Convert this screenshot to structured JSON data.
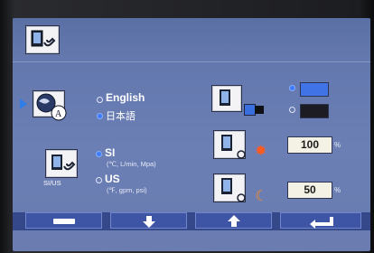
{
  "language": {
    "options": [
      {
        "label": "English",
        "selected": false
      },
      {
        "label": "日本語",
        "selected": true
      }
    ]
  },
  "units": {
    "icon_caption": "SI/US",
    "options": [
      {
        "label": "SI",
        "detail": "(℃, L/min, Mpa)",
        "selected": true
      },
      {
        "label": "US",
        "detail": "(℉, gpm, psi)",
        "selected": false
      }
    ]
  },
  "background": {
    "options": [
      {
        "color": "#3f73e6",
        "selected": true
      },
      {
        "color": "#1c1c22",
        "selected": false
      }
    ]
  },
  "brightness_day": {
    "value": "100",
    "unit": "%"
  },
  "brightness_night": {
    "value": "50",
    "unit": "%"
  },
  "footer_buttons": [
    {
      "icon": "enter-bar-icon"
    },
    {
      "icon": "arrow-down-icon"
    },
    {
      "icon": "arrow-up-icon"
    },
    {
      "icon": "return-icon"
    }
  ],
  "colors": {
    "accent": "#3e7bff",
    "panel": "#6b7fb5"
  }
}
